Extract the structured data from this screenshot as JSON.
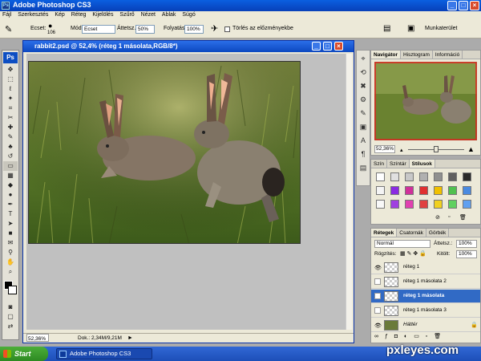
{
  "window": {
    "title": "Adobe Photoshop CS3"
  },
  "menu": [
    "Fájl",
    "Szerkesztés",
    "Kép",
    "Réteg",
    "Kijelölés",
    "Szűrő",
    "Nézet",
    "Ablak",
    "Súgó"
  ],
  "options": {
    "brush_label": "Ecset:",
    "brush_size": "106",
    "mode_label": "Mód:",
    "mode_value": "Ecset",
    "opacity_label": "Áttetsz.:",
    "opacity_value": "50%",
    "flow_label": "Folyatás:",
    "flow_value": "100%",
    "erase_history_label": "Törlés az előzményekbe",
    "workspace_label": "Munkaterület"
  },
  "document": {
    "title": "rabbit2.psd @ 52,4% (réteg 1 másolata,RGB/8*)",
    "zoom": "52,36%",
    "doc_size": "Dok.: 2,34M/9,21M"
  },
  "navigator": {
    "tabs": [
      "Navigátor",
      "Hisztogram",
      "Információ"
    ],
    "zoom": "52,36%"
  },
  "styles_panel": {
    "tabs": [
      "Szín",
      "Színtár",
      "Stílusok"
    ]
  },
  "layers_panel": {
    "tabs": [
      "Rétegek",
      "Csatornák",
      "Görbék"
    ],
    "blend_mode": "Normál",
    "opacity_label": "Áttetsz.:",
    "opacity_value": "100%",
    "lock_label": "Rögzítés:",
    "fill_label": "Kitölt:",
    "fill_value": "100%",
    "layers": [
      {
        "name": "réteg 1",
        "visible": true,
        "selected": false
      },
      {
        "name": "réteg 1 másolata 2",
        "visible": false,
        "selected": false
      },
      {
        "name": "réteg 1 másolata",
        "visible": false,
        "selected": true
      },
      {
        "name": "réteg 1 másolata 3",
        "visible": false,
        "selected": false
      },
      {
        "name": "Háttér",
        "visible": true,
        "selected": false
      }
    ]
  },
  "taskbar": {
    "start_label": "Start",
    "task_label": "Adobe Photoshop CS3"
  },
  "watermark": "pxleyes.com"
}
